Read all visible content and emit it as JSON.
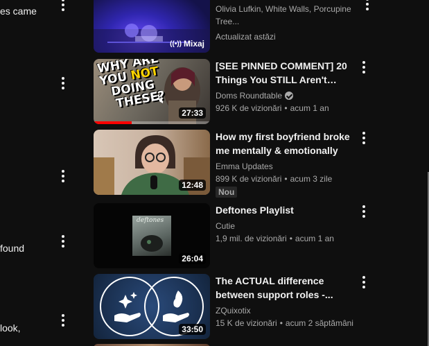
{
  "comments_column": {
    "fragments": [
      "es came",
      "found",
      "look,"
    ]
  },
  "videos": [
    {
      "title": "",
      "channel": "Olivia Lufkin, White Walls, Porcupine Tree...",
      "stats": "Actualizat astăzi",
      "badge": "Mixaj",
      "thumb_colors": [
        "#1b1a55",
        "#5f3bd1",
        "#2b2fa8"
      ]
    },
    {
      "title": "[SEE PINNED COMMENT] 20 Things You STILL Aren't Doing...",
      "channel": "Doms Roundtable",
      "verified": true,
      "views": "926 K de vizionări",
      "age": "acum 1 an",
      "duration": "27:33",
      "watched_fraction": 0.33,
      "thumb_text": [
        "WHY ARE",
        "YOU ",
        "NOT",
        " DOING",
        "THESE?"
      ]
    },
    {
      "title": "How my first boyfriend broke me mentally & emotionally",
      "channel": "Emma Updates",
      "views": "899 K de vizionări",
      "age": "acum 3 zile",
      "new_badge": "Nou",
      "duration": "12:48"
    },
    {
      "title": "Deftones Playlist",
      "channel": "Cutie",
      "views": "1,9 mil. de vizionări",
      "age": "acum 1 an",
      "duration": "26:04",
      "album_text": "deftones"
    },
    {
      "title": "The ACTUAL difference between support roles -...",
      "channel": "ZQuixotix",
      "views": "15 K de vizionări",
      "age": "acum 2 săptămâni",
      "duration": "33:50"
    }
  ],
  "colors": {
    "background": "#0f0f0f",
    "text_primary": "#f1f1f1",
    "text_secondary": "#aaaaaa",
    "progress": "#ff0000",
    "accent_yellow": "#ffd400"
  }
}
